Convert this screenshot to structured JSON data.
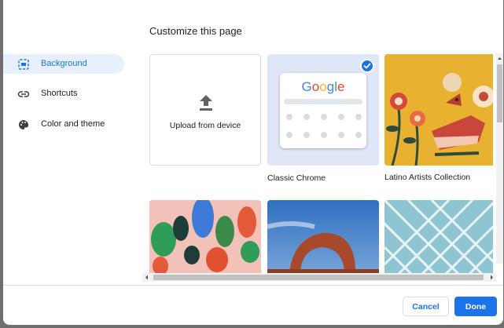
{
  "dialog": {
    "title": "Customize this page"
  },
  "sidebar": {
    "items": [
      {
        "label": "Background",
        "icon": "background-icon",
        "selected": true
      },
      {
        "label": "Shortcuts",
        "icon": "link-icon",
        "selected": false
      },
      {
        "label": "Color and theme",
        "icon": "palette-icon",
        "selected": false
      }
    ]
  },
  "backgrounds": {
    "upload_label": "Upload from device",
    "classic_label": "Classic Chrome",
    "classic_logo": "Google",
    "latino_label": "Latino Artists Collection"
  },
  "footer": {
    "cancel_label": "Cancel",
    "done_label": "Done"
  },
  "colors": {
    "accent": "#1a73e8",
    "selected_bg": "#e8f0fe"
  }
}
